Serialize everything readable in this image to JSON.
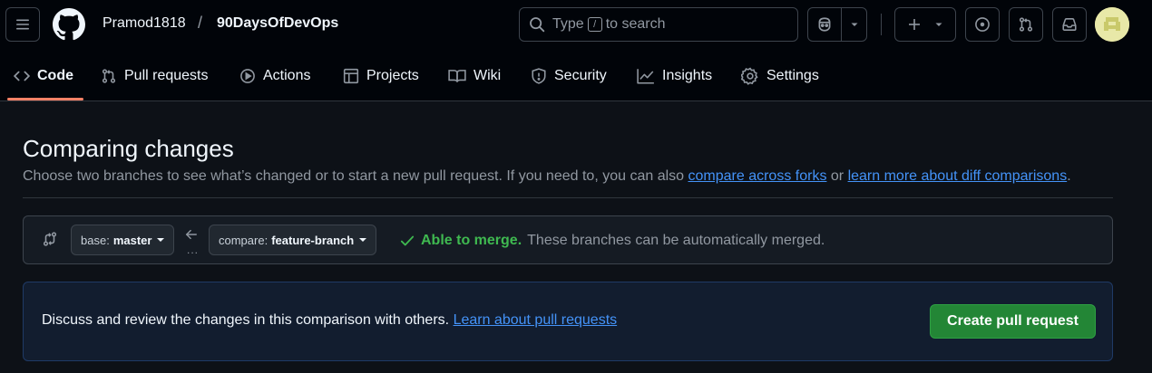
{
  "header": {
    "owner": "Pramod1818",
    "separator": "/",
    "repo": "90DaysOfDevOps",
    "search": {
      "prefix": "Type",
      "key": "/",
      "suffix": "to search"
    }
  },
  "nav": {
    "tabs": [
      {
        "label": "Code",
        "icon": "code-icon",
        "active": true
      },
      {
        "label": "Pull requests",
        "icon": "git-pull-request-icon"
      },
      {
        "label": "Actions",
        "icon": "play-icon"
      },
      {
        "label": "Projects",
        "icon": "table-icon"
      },
      {
        "label": "Wiki",
        "icon": "book-icon"
      },
      {
        "label": "Security",
        "icon": "shield-icon"
      },
      {
        "label": "Insights",
        "icon": "graph-icon"
      },
      {
        "label": "Settings",
        "icon": "gear-icon"
      }
    ]
  },
  "main": {
    "title": "Comparing changes",
    "subtitle_prefix": "Choose two branches to see what’s changed or to start a new pull request. If you need to, you can also",
    "link_forks": "compare across forks",
    "subtitle_or": "or",
    "link_diff": "learn more about diff comparisons",
    "subtitle_end": ".",
    "base_key": "base:",
    "base_value": "master",
    "compare_key": "compare:",
    "compare_value": "feature-branch",
    "dots": "...",
    "merge_ok": "Able to merge.",
    "merge_desc": "These branches can be automatically merged.",
    "discuss_text": "Discuss and review the changes in this comparison with others.",
    "discuss_link": "Learn about pull requests",
    "create_button": "Create pull request"
  },
  "colors": {
    "accent_link": "#4493f8",
    "success": "#3fb950",
    "primary_button": "#238636",
    "tab_underline": "#f78166"
  }
}
